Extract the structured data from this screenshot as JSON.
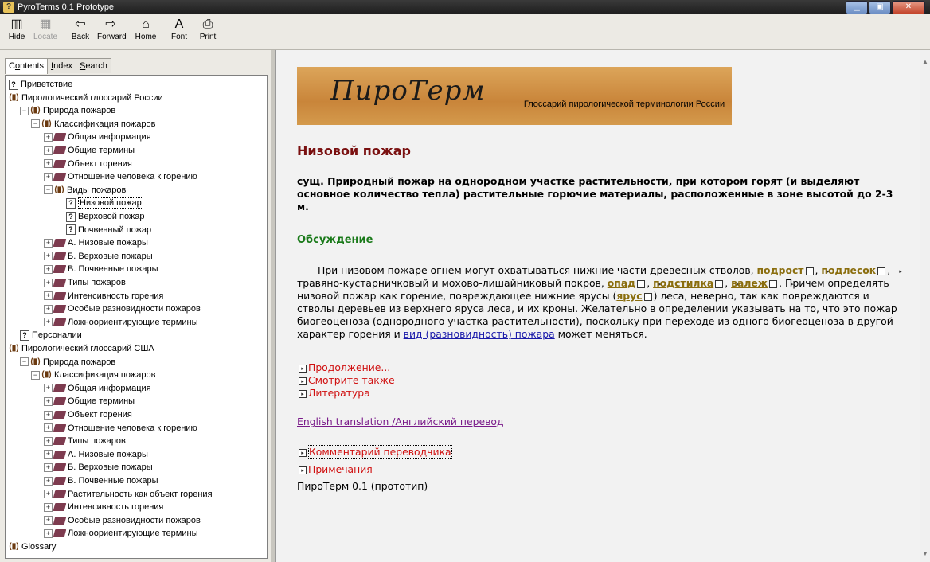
{
  "window": {
    "title": "PyroTerms 0.1 Prototype"
  },
  "toolbar": {
    "buttons": [
      {
        "label": "Hide",
        "icon": "hide-icon",
        "glyph": "▥",
        "enabled": true
      },
      {
        "label": "Locate",
        "icon": "locate-icon",
        "glyph": "▦",
        "enabled": false
      },
      {
        "label": "Back",
        "icon": "back-arrow-icon",
        "glyph": "⇦",
        "enabled": true
      },
      {
        "label": "Forward",
        "icon": "forward-arrow-icon",
        "glyph": "⇨",
        "enabled": true
      },
      {
        "label": "Home",
        "icon": "home-icon",
        "glyph": "⌂",
        "enabled": true
      },
      {
        "label": "Font",
        "icon": "font-icon",
        "glyph": "A",
        "enabled": true
      },
      {
        "label": "Print",
        "icon": "printer-icon",
        "glyph": "⎙",
        "enabled": true
      }
    ]
  },
  "tabs": [
    {
      "pre": "C",
      "under": "o",
      "post": "ntents"
    },
    {
      "pre": "",
      "under": "I",
      "post": "ndex"
    },
    {
      "pre": "",
      "under": "S",
      "post": "earch"
    }
  ],
  "tree": [
    {
      "level": 0,
      "icon": "page",
      "label": "Приветствие"
    },
    {
      "level": 0,
      "icon": "book-open",
      "label": "Пирологический глоссарий России"
    },
    {
      "level": 1,
      "icon": "book-open",
      "label": "Природа пожаров",
      "exp": "−"
    },
    {
      "level": 2,
      "icon": "book-open",
      "label": "Классификация пожаров",
      "exp": "−"
    },
    {
      "level": 3,
      "icon": "book",
      "label": "Общая информация",
      "exp": "+"
    },
    {
      "level": 3,
      "icon": "book",
      "label": "Общие термины",
      "exp": "+"
    },
    {
      "level": 3,
      "icon": "book",
      "label": "Объект горения",
      "exp": "+"
    },
    {
      "level": 3,
      "icon": "book",
      "label": "Отношение человека к горению",
      "exp": "+"
    },
    {
      "level": 3,
      "icon": "book-open",
      "label": "Виды пожаров",
      "exp": "−"
    },
    {
      "level": 4,
      "icon": "page",
      "label": "Низовой пожар",
      "selected": true
    },
    {
      "level": 4,
      "icon": "page",
      "label": "Верховой пожар"
    },
    {
      "level": 4,
      "icon": "page",
      "label": "Почвенный пожар"
    },
    {
      "level": 3,
      "icon": "book",
      "label": "А. Низовые пожары",
      "exp": "+"
    },
    {
      "level": 3,
      "icon": "book",
      "label": "Б. Верховые пожары",
      "exp": "+"
    },
    {
      "level": 3,
      "icon": "book",
      "label": "В. Почвенные пожары",
      "exp": "+"
    },
    {
      "level": 3,
      "icon": "book",
      "label": "Типы пожаров",
      "exp": "+"
    },
    {
      "level": 3,
      "icon": "book",
      "label": "Интенсивность горения",
      "exp": "+"
    },
    {
      "level": 3,
      "icon": "book",
      "label": "Особые разновидности пожаров",
      "exp": "+"
    },
    {
      "level": 3,
      "icon": "book",
      "label": "Ложноориентирующие термины",
      "exp": "+"
    },
    {
      "level": 1,
      "icon": "page",
      "label": "Персоналии"
    },
    {
      "level": 0,
      "icon": "book-open",
      "label": "Пирологический глоссарий США"
    },
    {
      "level": 1,
      "icon": "book-open",
      "label": "Природа пожаров",
      "exp": "−"
    },
    {
      "level": 2,
      "icon": "book-open",
      "label": "Классификация пожаров",
      "exp": "−"
    },
    {
      "level": 3,
      "icon": "book",
      "label": "Общая информация",
      "exp": "+"
    },
    {
      "level": 3,
      "icon": "book",
      "label": "Общие термины",
      "exp": "+"
    },
    {
      "level": 3,
      "icon": "book",
      "label": "Объект горения",
      "exp": "+"
    },
    {
      "level": 3,
      "icon": "book",
      "label": "Отношение человека к горению",
      "exp": "+"
    },
    {
      "level": 3,
      "icon": "book",
      "label": "Типы пожаров",
      "exp": "+"
    },
    {
      "level": 3,
      "icon": "book",
      "label": "А. Низовые пожары",
      "exp": "+"
    },
    {
      "level": 3,
      "icon": "book",
      "label": "Б. Верховые пожары",
      "exp": "+"
    },
    {
      "level": 3,
      "icon": "book",
      "label": "В. Почвенные пожары",
      "exp": "+"
    },
    {
      "level": 3,
      "icon": "book",
      "label": "Растительность как объект горения",
      "exp": "+"
    },
    {
      "level": 3,
      "icon": "book",
      "label": "Интенсивность горения",
      "exp": "+"
    },
    {
      "level": 3,
      "icon": "book",
      "label": "Особые разновидности пожаров",
      "exp": "+"
    },
    {
      "level": 3,
      "icon": "book",
      "label": "Ложноориентирующие термины",
      "exp": "+"
    },
    {
      "level": 0,
      "icon": "book-open",
      "label": "Glossary"
    }
  ],
  "banner": {
    "title": "ПироТерм",
    "subtitle": "Глоссарий пирологической терминологии России"
  },
  "article": {
    "heading": "Низовой пожар",
    "definition": "сущ. Природный пожар на однородном участке растительности, при котором горят (и выделяют основное количество тепла) растительные горючие материалы, расположенные в зоне высотой до 2-3 м.",
    "discussion_heading": "Обсуждение",
    "paragraph": {
      "t1": "При низовом пожаре огнем могут охватываться нижние части древесных стволов, ",
      "k1": "подрост",
      "t2": ", ",
      "k2": "подлесок",
      "t3": ", травяно-кустарничковый и мохово-лишайниковый покров, ",
      "k3": "опад",
      "t4": ", ",
      "k4": "подстилка",
      "t5": ", ",
      "k5": "валеж",
      "t6": ". Причем определять низовой пожар как горение, повреждающее нижние ярусы (",
      "k6": "ярус",
      "t7": ") леса, неверно, так как повреждаются и стволы деревьев из верхнего яруса леса, и их кроны. Желательно в определении указывать на то, что это пожар биогеоценоза (однородного участка растительности), поскольку при переходе из одного биогеоценоза в другой характер горения и ",
      "link": "вид (разновидность) пожара",
      "t8": " может меняться."
    },
    "expanders": [
      "Продолжение...",
      "Смотрите также",
      "Литература"
    ],
    "english_link": "English translation /Английский перевод",
    "translator_comment": "Комментарий переводчика",
    "notes": "Примечания",
    "footer": "ПироТерм 0.1 (прототип)"
  }
}
